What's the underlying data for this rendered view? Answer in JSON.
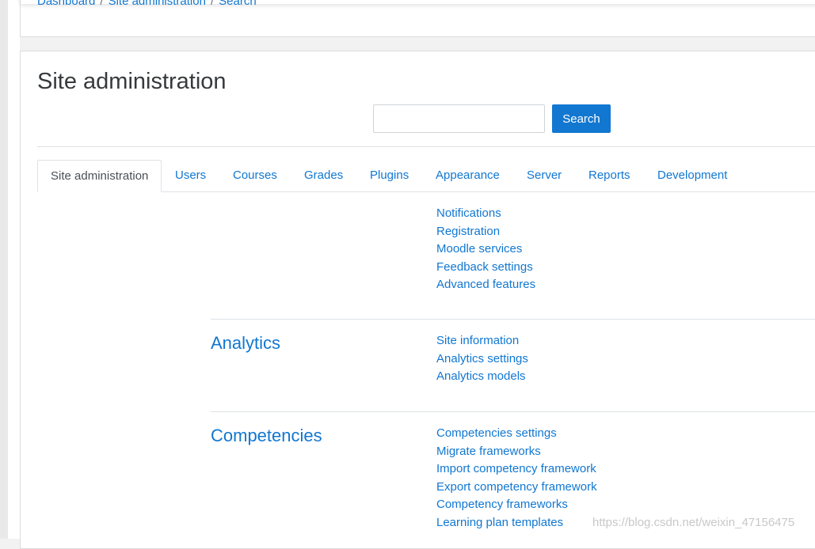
{
  "breadcrumb": {
    "items": [
      "Dashboard",
      "Site administration",
      "Search"
    ],
    "separator": "/"
  },
  "page": {
    "title": "Site administration"
  },
  "search": {
    "value": "",
    "button_label": "Search"
  },
  "tabs": [
    {
      "label": "Site administration",
      "active": true
    },
    {
      "label": "Users",
      "active": false
    },
    {
      "label": "Courses",
      "active": false
    },
    {
      "label": "Grades",
      "active": false
    },
    {
      "label": "Plugins",
      "active": false
    },
    {
      "label": "Appearance",
      "active": false
    },
    {
      "label": "Server",
      "active": false
    },
    {
      "label": "Reports",
      "active": false
    },
    {
      "label": "Development",
      "active": false
    }
  ],
  "general_links": [
    "Notifications",
    "Registration",
    "Moodle services",
    "Feedback settings",
    "Advanced features"
  ],
  "sections": [
    {
      "heading": "Analytics",
      "links": [
        "Site information",
        "Analytics settings",
        "Analytics models"
      ]
    },
    {
      "heading": "Competencies",
      "links": [
        "Competencies settings",
        "Migrate frameworks",
        "Import competency framework",
        "Export competency framework",
        "Competency frameworks",
        "Learning plan templates"
      ]
    }
  ],
  "watermark": "https://blog.csdn.net/weixin_47156475",
  "colors": {
    "link": "#1177d1",
    "button": "#1177d1",
    "text": "#373a3c"
  }
}
